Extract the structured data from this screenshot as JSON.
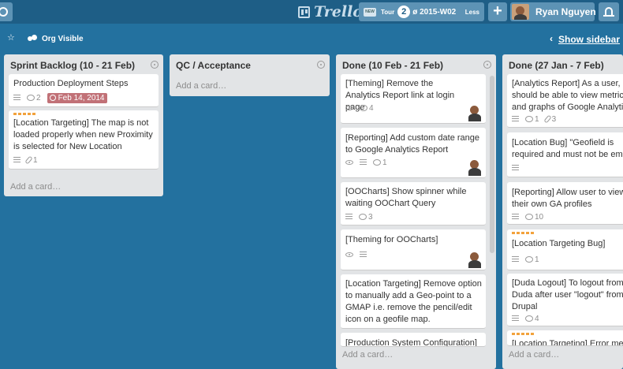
{
  "header": {
    "logo": "Trello",
    "board_switcher": {
      "mini": "NEW",
      "tour": "Tour",
      "badge": "2",
      "name": "ø 2015-W02",
      "less": "Less"
    },
    "plus": "+",
    "user_name": "Ryan Nguyen"
  },
  "board_bar": {
    "visibility": "Org Visible",
    "show_sidebar": "Show sidebar"
  },
  "lists": [
    {
      "title": "Sprint Backlog (10 - 21 Feb)",
      "add_card": "Add a card…",
      "cards": [
        {
          "title": "Production Deployment Steps",
          "comments": "2",
          "due": "Feb 14, 2014"
        },
        {
          "title": "[Location Targeting] The map is not loaded properly when new Proximity is selected for New Location",
          "attachments": "1"
        }
      ]
    },
    {
      "title": "QC / Acceptance",
      "add_card": "Add a card…",
      "cards": []
    },
    {
      "title": "Done (10 Feb - 21 Feb)",
      "add_card": "Add a card…",
      "cards": [
        {
          "title": "[Theming] Remove the Analytics Report link at login page",
          "comments": "4"
        },
        {
          "title": "[Reporting] Add custom date range to Google Analytics Report",
          "comments": "1"
        },
        {
          "title": "[OOCharts] Show spinner while waiting OOChart Query",
          "comments": "3"
        },
        {
          "title": "[Theming for OOCharts]"
        },
        {
          "title": "[Location Targeting] Remove option to manually add a Geo-point to a GMAP i.e. remove the pencil/edit icon on a geofile map."
        },
        {
          "title": "[Production System Configuration]"
        }
      ]
    },
    {
      "title": "Done (27 Jan - 7 Feb)",
      "add_card": "Add a card…",
      "cards": [
        {
          "title": "[Analytics Report] As a user, I should be able to view metrics and graphs of Google Analytics",
          "comments": "1",
          "attachments": "3"
        },
        {
          "title": "[Location Bug] \"Geofield is required and must not be empty\""
        },
        {
          "title": "[Reporting] Allow user to view their own GA profiles",
          "comments": "10"
        },
        {
          "title": "[Location Targeting Bug]",
          "comments": "1"
        },
        {
          "title": "[Duda Logout] To logout from Duda after user \"logout\" from Drupal",
          "comments": "4"
        },
        {
          "title": "[Location Targeting] Error message"
        }
      ]
    }
  ]
}
